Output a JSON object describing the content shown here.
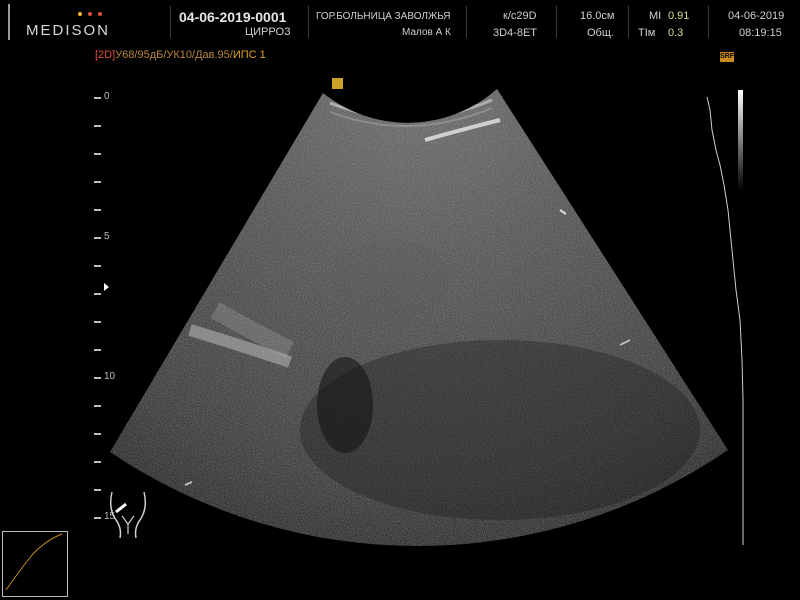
{
  "header": {
    "brand": "MEDISON",
    "brand_dot_colors": [
      "#f0b030",
      "#e05040",
      "#e05040"
    ],
    "study_id": "04-06-2019-0001",
    "study_note": "ЦИРРОЗ",
    "hospital": "ГОР.БОЛЬНИЦА ЗАВОЛЖЬЯ",
    "doctor": "Малов А К",
    "probe": "к/с29D",
    "probe_model": "3D4-8ET",
    "depth": "16.0см",
    "preset": "Общ.",
    "mi_label": "MI",
    "mi_value": "0.91",
    "ti_label": "TIм",
    "ti_value": "0.3",
    "date": "04-06-2019",
    "time": "08:19:15"
  },
  "params": {
    "mode": "[2D]",
    "settings": "У68/95дБ/УК10/Дав.95/",
    "ips": "ИПС 1"
  },
  "scale": {
    "labels": [
      "0",
      "5",
      "10",
      "15"
    ]
  },
  "badges": {
    "srf": "SRF"
  },
  "colors": {
    "accent_orange": "#d98c1c",
    "mode_red": "#e04a3a",
    "index_green": "#c8e08a"
  }
}
